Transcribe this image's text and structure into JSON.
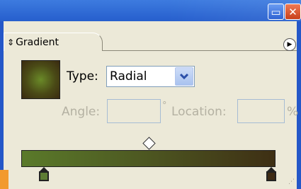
{
  "window": {
    "minimize_glyph": "▭",
    "close_glyph": "✕"
  },
  "panel": {
    "tab_icon": "⇕",
    "tab_label": "Gradient",
    "menu_glyph": "▶"
  },
  "gradient": {
    "type_label": "Type:",
    "type_value": "Radial",
    "angle_label": "Angle:",
    "angle_value": "",
    "degree_symbol": "°",
    "location_label": "Location:",
    "location_value": "",
    "percent_symbol": "%",
    "colors": {
      "start_stop": "#5e7d34",
      "end_stop": "#3e2b14"
    }
  }
}
